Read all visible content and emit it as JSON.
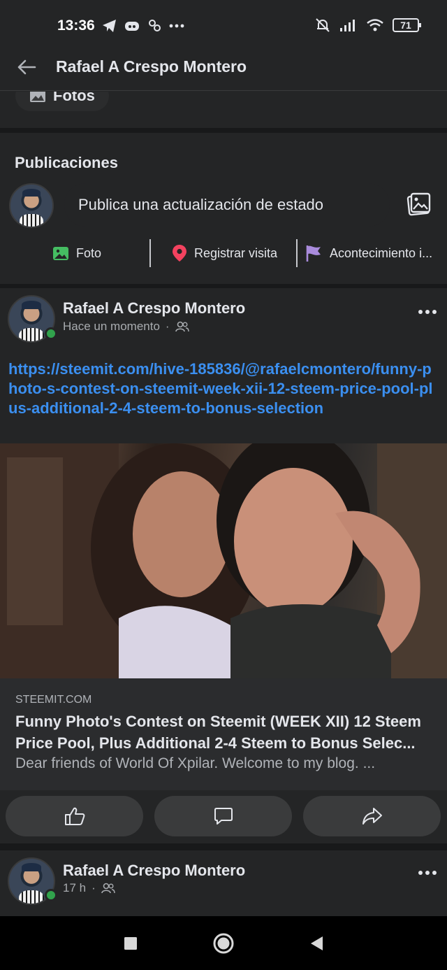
{
  "status_bar": {
    "time": "13:36",
    "battery": "71"
  },
  "header": {
    "title": "Rafael A Crespo Montero"
  },
  "fotos_tab": {
    "label": "Fotos"
  },
  "publications": {
    "title": "Publicaciones",
    "status_placeholder": "Publica una actualización de estado",
    "actions": [
      {
        "label": "Foto",
        "icon": "photo-icon"
      },
      {
        "label": "Registrar visita",
        "icon": "location-pin-icon"
      },
      {
        "label": "Acontecimiento i...",
        "icon": "flag-icon"
      }
    ]
  },
  "post1": {
    "author": "Rafael A Crespo Montero",
    "time": "Hace un momento",
    "audience_icon": "friends-icon",
    "link_text": "https://steemit.com/hive-185836/@rafaelcmontero/funny-photo-s-contest-on-steemit-week-xii-12-steem-price-pool-plus-additional-2-4-steem-to-bonus-selection",
    "card": {
      "domain": "STEEMIT.COM",
      "title": "Funny Photo's Contest on Steemit (WEEK XII) 12 Steem Price Pool, Plus Additional 2-4 Steem to Bonus Selec...",
      "description": "Dear friends of World Of Xpilar. Welcome to my blog. ..."
    },
    "reactions": [
      "like-icon",
      "comment-icon",
      "share-icon"
    ]
  },
  "post2": {
    "author": "Rafael A Crespo Montero",
    "time": "17 h",
    "audience_icon": "friends-icon"
  },
  "colors": {
    "background": "#242526",
    "separator": "#18191a",
    "link": "#3b8ff0",
    "online": "#31a24c"
  }
}
